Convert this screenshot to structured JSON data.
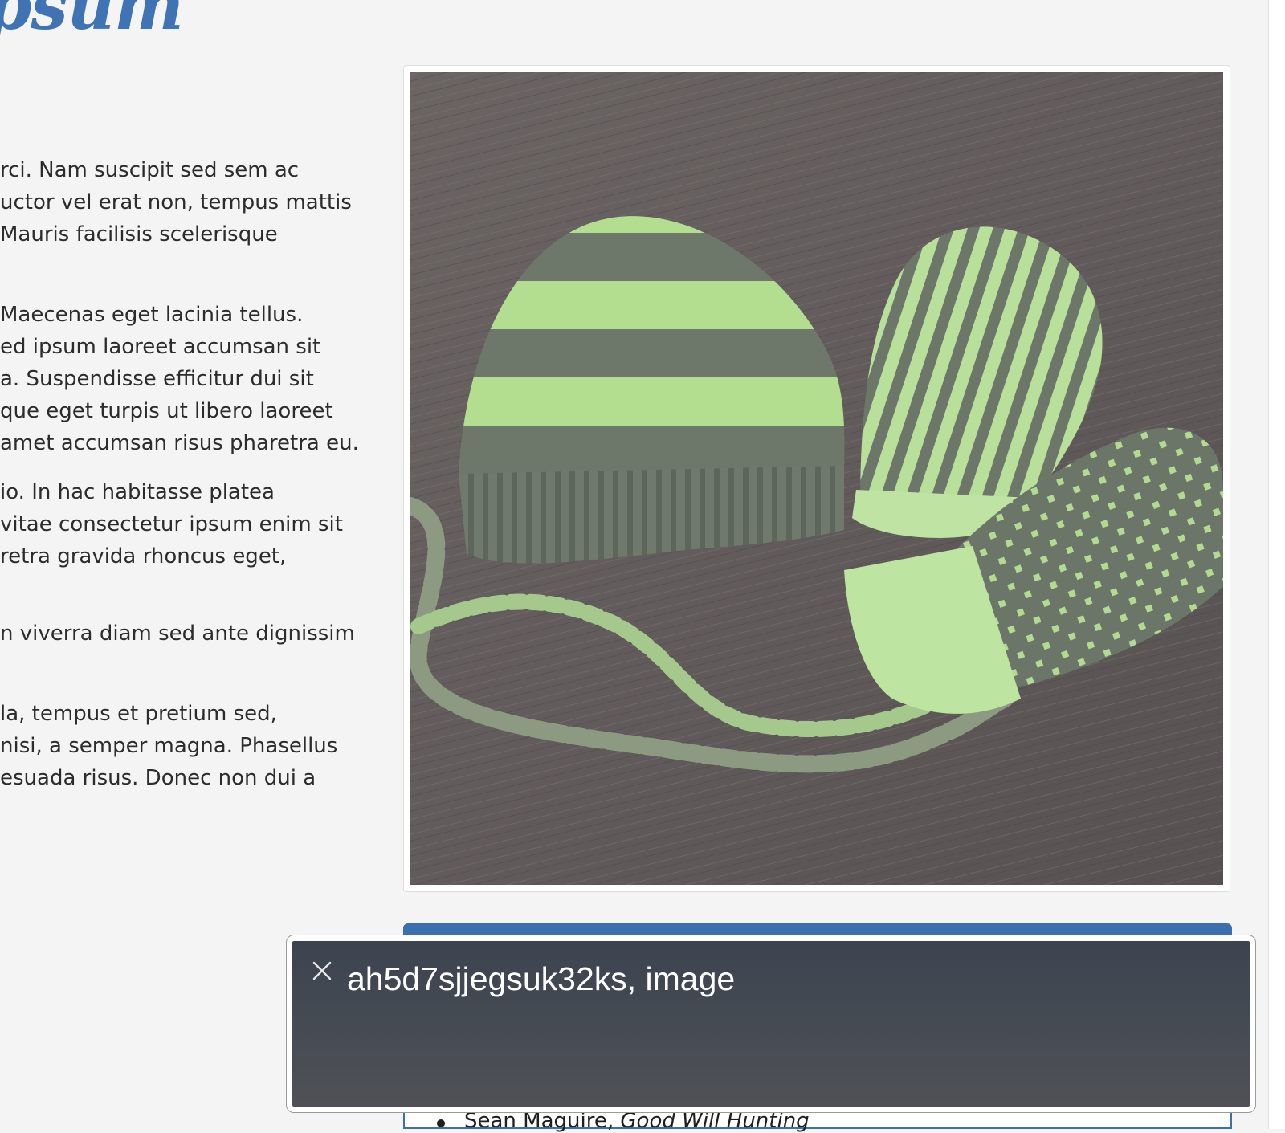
{
  "page": {
    "heading": "psum",
    "paragraphs": [
      {
        "lines": [
          "rci. Nam suscipit sed sem ac",
          "uctor vel erat non, tempus mattis",
          "Mauris facilisis scelerisque"
        ]
      },
      {
        "lines": [
          "Maecenas eget lacinia tellus.",
          "ed ipsum laoreet accumsan sit",
          "a. Suspendisse efficitur dui sit",
          "que eget turpis ut libero laoreet",
          "amet accumsan risus pharetra eu."
        ]
      },
      {
        "lines": [
          "io. In hac habitasse platea",
          "vitae consectetur ipsum enim sit",
          "retra gravida rhoncus eget,"
        ]
      },
      {
        "lines": [
          "n viverra diam sed ante dignissim"
        ]
      },
      {
        "lines": [
          "la, tempus et pretium sed,",
          "nisi, a semper magna. Phasellus",
          "esuada risus. Donec non dui a"
        ]
      }
    ]
  },
  "credits": {
    "items": [
      {
        "name": "Sean Maguire, ",
        "title": "Good Will Hunting"
      }
    ]
  },
  "caption": {
    "text": "ah5d7sjjegsuk32ks, image",
    "close_icon": "close-icon"
  },
  "colors": {
    "heading": "#3f73b4",
    "panel_accent": "#3b6fb0",
    "caption_bg": "#434a54",
    "yarn_green": "#b4de8f",
    "yarn_gray": "#6d786a",
    "wood": "#6b6463"
  }
}
